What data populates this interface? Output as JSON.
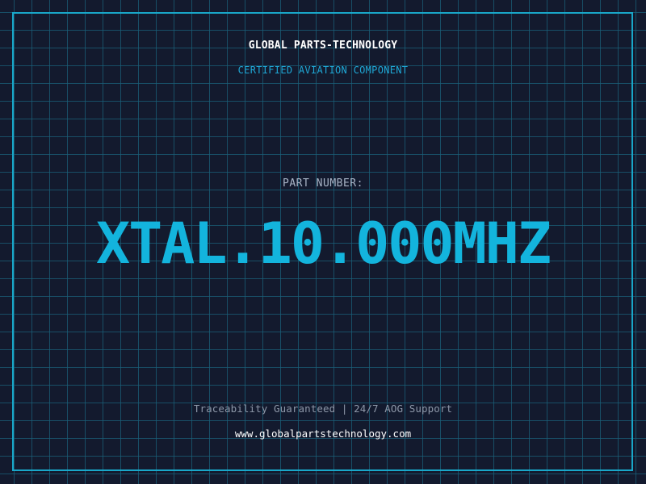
{
  "header": {
    "company_name": "GLOBAL PARTS-TECHNOLOGY",
    "subtitle": "CERTIFIED AVIATION COMPONENT"
  },
  "part": {
    "label": "PART NUMBER:",
    "number": "XTAL.10.000MHZ"
  },
  "footer": {
    "tagline": "Traceability Guaranteed | 24/7 AOG Support",
    "website": "www.globalpartstechnology.com"
  },
  "colors": {
    "background": "#131a2e",
    "grid": "#1a5f78",
    "frame": "#19a7c9",
    "accent": "#13b4dd",
    "subtitle": "#1fa8d6",
    "label": "#a8b4c6",
    "muted": "#8d97a8",
    "text": "#ffffff"
  }
}
